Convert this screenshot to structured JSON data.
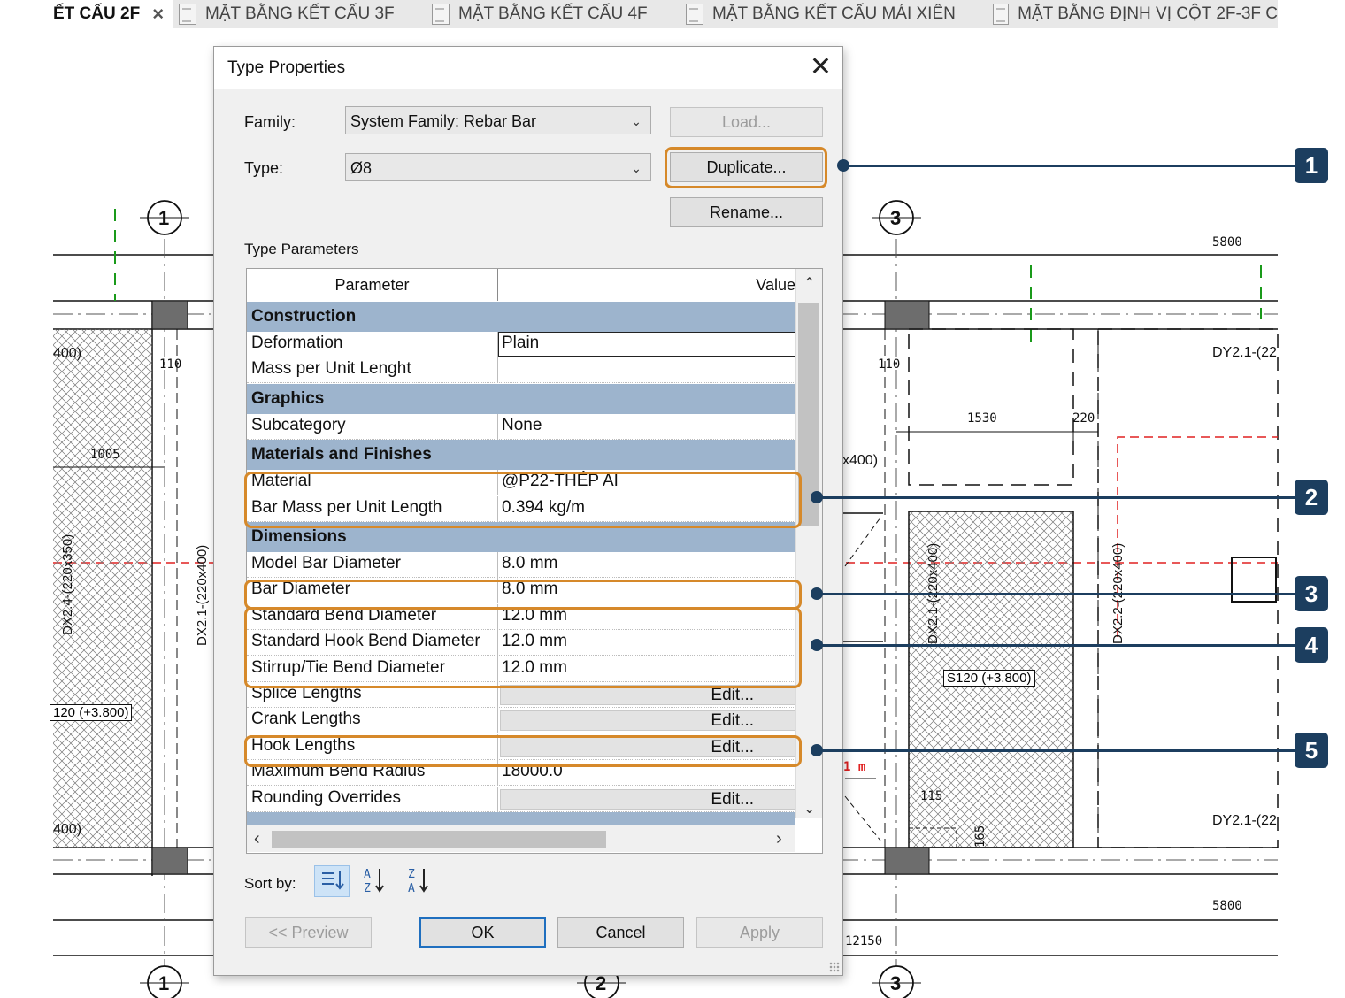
{
  "tabs": [
    {
      "label": "ẾT CẤU 2F",
      "active": true
    },
    {
      "label": "MẶT BẰNG KẾT CẤU 3F"
    },
    {
      "label": "MẶT BẰNG KẾT CẤU 4F"
    },
    {
      "label": "MẶT BẰNG KẾT CẤU MÁI XIÊN"
    },
    {
      "label": "MẶT BẰNG ĐỊNH VỊ CỘT 2F-3F C"
    }
  ],
  "tab_close_glyph": "×",
  "drawing": {
    "grid_bubbles": [
      "1",
      "3",
      "1",
      "2",
      "3"
    ],
    "dims": [
      "5800",
      "1005",
      "1530",
      "220",
      "5800",
      "12150",
      "115",
      "165",
      "1 m"
    ],
    "labels": [
      "400)",
      "400)",
      "DY2.1-(22",
      "DY2.1-(22",
      "x400)"
    ],
    "vertical_labels": [
      "DX2.4-(220x350)",
      "DX2.1-(220x400)",
      "DX2.1-(220x400)",
      "DX2.2-(220x400)"
    ],
    "tags": [
      "120 (+3.800)",
      "S120 (+3.800)"
    ],
    "small_dims": [
      "110",
      "110"
    ]
  },
  "dialog": {
    "title": "Type Properties",
    "close_glyph": "✕",
    "family_label": "Family:",
    "family_value": "System Family: Rebar Bar",
    "type_label": "Type:",
    "type_value": "Ø8",
    "load_button": "Load...",
    "duplicate_button": "Duplicate...",
    "rename_button": "Rename...",
    "section_label": "Type Parameters",
    "col_parameter": "Parameter",
    "col_value": "Value",
    "rows": [
      {
        "kind": "cat",
        "name": "Construction"
      },
      {
        "kind": "param",
        "name": "Deformation",
        "value": "Plain",
        "input": true
      },
      {
        "kind": "param",
        "name": "Mass per Unit Lenght",
        "value": ""
      },
      {
        "kind": "cat",
        "name": "Graphics"
      },
      {
        "kind": "param",
        "name": "Subcategory",
        "value": "None"
      },
      {
        "kind": "cat",
        "name": "Materials and Finishes"
      },
      {
        "kind": "param",
        "name": "Material",
        "value": "@P22-THÉP AI"
      },
      {
        "kind": "param",
        "name": "Bar Mass per Unit Length",
        "value": "0.394 kg/m"
      },
      {
        "kind": "cat",
        "name": "Dimensions"
      },
      {
        "kind": "param",
        "name": "Model Bar Diameter",
        "value": "8.0 mm"
      },
      {
        "kind": "param",
        "name": "Bar Diameter",
        "value": "8.0 mm"
      },
      {
        "kind": "param",
        "name": "Standard Bend Diameter",
        "value": "12.0 mm"
      },
      {
        "kind": "param",
        "name": "Standard Hook Bend Diameter",
        "value": "12.0 mm"
      },
      {
        "kind": "param",
        "name": "Stirrup/Tie Bend Diameter",
        "value": "12.0 mm"
      },
      {
        "kind": "edit",
        "name": "Splice Lengths",
        "value": "Edit..."
      },
      {
        "kind": "edit",
        "name": "Crank Lengths",
        "value": "Edit..."
      },
      {
        "kind": "edit",
        "name": "Hook Lengths",
        "value": "Edit..."
      },
      {
        "kind": "param",
        "name": "Maximum Bend Radius",
        "value": "18000.0"
      },
      {
        "kind": "edit",
        "name": "Rounding Overrides",
        "value": "Edit..."
      },
      {
        "kind": "cat",
        "name": ""
      }
    ],
    "sort_label": "Sort by:",
    "sort_icons": [
      "sort-grouped-icon",
      "sort-a-z-icon",
      "sort-z-a-icon"
    ],
    "preview_button": "<< Preview",
    "ok_button": "OK",
    "cancel_button": "Cancel",
    "apply_button": "Apply"
  },
  "callouts": [
    "1",
    "2",
    "3",
    "4",
    "5"
  ],
  "colors": {
    "highlight": "#d6892a",
    "callout": "#1c3e5f",
    "category_row": "#9db4cd",
    "grid_line_red": "#e02020",
    "grid_line_green": "#1a9a1a"
  }
}
